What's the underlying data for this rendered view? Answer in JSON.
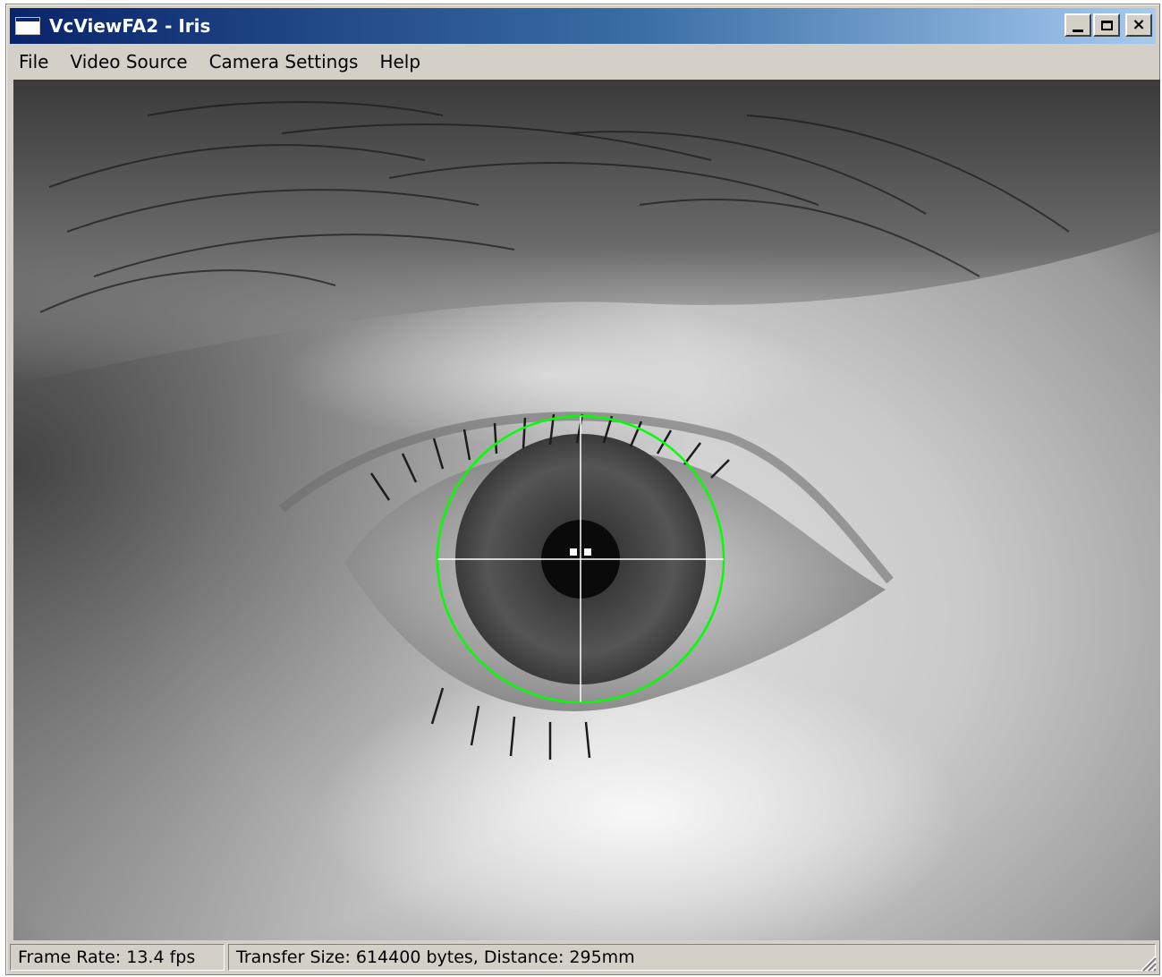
{
  "window": {
    "title": "VcViewFA2 - Iris",
    "icon": "application-window-icon"
  },
  "title_buttons": {
    "minimize": "minimize-icon",
    "maximize": "maximize-icon",
    "close_glyph": "×"
  },
  "menu": [
    {
      "label": "File"
    },
    {
      "label": "Video Source"
    },
    {
      "label": "Camera Settings"
    },
    {
      "label": "Help"
    }
  ],
  "overlay": {
    "circle_color": "#00ff00",
    "crosshair_color": "#ffffff"
  },
  "status": {
    "frame_rate": "Frame Rate: 13.4 fps",
    "transfer": "Transfer Size: 614400 bytes, Distance: 295mm"
  }
}
